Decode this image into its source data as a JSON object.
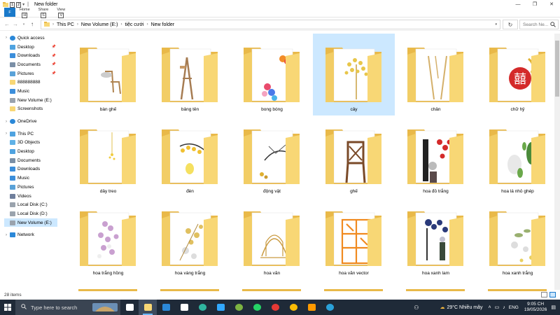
{
  "window": {
    "title": "New folder",
    "minimize_glyph": "—",
    "restore_glyph": "❐",
    "close_glyph": "✕"
  },
  "ribbon": {
    "file_label": "F",
    "tabs": [
      {
        "label": "Home",
        "keytip": "H"
      },
      {
        "label": "Share",
        "keytip": "S"
      },
      {
        "label": "View",
        "keytip": "V"
      }
    ],
    "qat_keytips": [
      "1",
      "2"
    ]
  },
  "address": {
    "crumbs": [
      "This PC",
      "New Volume (E:)",
      "tiệc cưới",
      "New folder"
    ],
    "search_placeholder": "Search Ne..."
  },
  "sidebar": {
    "items": [
      {
        "label": "Quick access",
        "icon": "star-icon",
        "top": true,
        "pinned": false
      },
      {
        "label": "Desktop",
        "icon": "desktop-folder-icon",
        "top": false,
        "pinned": true
      },
      {
        "label": "Downloads",
        "icon": "downloads-folder-icon",
        "top": false,
        "pinned": true
      },
      {
        "label": "Documents",
        "icon": "documents-folder-icon",
        "top": false,
        "pinned": true
      },
      {
        "label": "Pictures",
        "icon": "pictures-folder-icon",
        "top": false,
        "pinned": true
      },
      {
        "label": "888888888",
        "icon": "folder-icon",
        "top": false,
        "pinned": false
      },
      {
        "label": "Music",
        "icon": "music-icon",
        "top": false,
        "pinned": false
      },
      {
        "label": "New Volume (E:)",
        "icon": "drive-icon",
        "top": false,
        "pinned": false
      },
      {
        "label": "Screenshots",
        "icon": "folder-icon",
        "top": false,
        "pinned": false
      },
      {
        "gap": true
      },
      {
        "label": "OneDrive",
        "icon": "cloud-icon",
        "top": true,
        "pinned": false
      },
      {
        "gap": true
      },
      {
        "label": "This PC",
        "icon": "computer-icon",
        "top": true,
        "pinned": false
      },
      {
        "label": "3D Objects",
        "icon": "3d-objects-icon",
        "top": false,
        "pinned": false
      },
      {
        "label": "Desktop",
        "icon": "desktop-folder-icon",
        "top": false,
        "pinned": false
      },
      {
        "label": "Documents",
        "icon": "documents-folder-icon",
        "top": false,
        "pinned": false
      },
      {
        "label": "Downloads",
        "icon": "downloads-folder-icon",
        "top": false,
        "pinned": false
      },
      {
        "label": "Music",
        "icon": "music-icon",
        "top": false,
        "pinned": false
      },
      {
        "label": "Pictures",
        "icon": "pictures-folder-icon",
        "top": false,
        "pinned": false
      },
      {
        "label": "Videos",
        "icon": "videos-folder-icon",
        "top": false,
        "pinned": false
      },
      {
        "label": "Local Disk (C:)",
        "icon": "drive-icon",
        "top": false,
        "pinned": false
      },
      {
        "label": "Local Disk (D:)",
        "icon": "drive-icon",
        "top": false,
        "pinned": false
      },
      {
        "label": "New Volume (E:)",
        "icon": "drive-icon",
        "top": false,
        "pinned": false,
        "selected": true
      },
      {
        "gap": true
      },
      {
        "label": "Network",
        "icon": "network-icon",
        "top": true,
        "pinned": false
      }
    ]
  },
  "folders": [
    {
      "name": "bàn ghế",
      "thumb": "chair"
    },
    {
      "name": "bảng tên",
      "thumb": "easel"
    },
    {
      "name": "bong bóng",
      "thumb": "balloons"
    },
    {
      "name": "cây",
      "thumb": "tree",
      "selected": true
    },
    {
      "name": "chân",
      "thumb": "legs"
    },
    {
      "name": "chữ hỷ",
      "thumb": "double-happiness"
    },
    {
      "name": "dây treo",
      "thumb": "hanging"
    },
    {
      "name": "đèn",
      "thumb": "lamp"
    },
    {
      "name": "động vật",
      "thumb": "crane-bird"
    },
    {
      "name": "ghế",
      "thumb": "wood-chair"
    },
    {
      "name": "hoa đỏ trắng",
      "thumb": "red-white-flowers"
    },
    {
      "name": "hoa lá nhỏ ghép",
      "thumb": "leaves"
    },
    {
      "name": "hoa trắng hồng",
      "thumb": "pink-white-flowers"
    },
    {
      "name": "hoa vàng trắng",
      "thumb": "yellow-white-flowers"
    },
    {
      "name": "hoa văn",
      "thumb": "gold-pattern"
    },
    {
      "name": "hoa văn vector",
      "thumb": "orange-lattice"
    },
    {
      "name": "hoa xanh lam",
      "thumb": "blue-flowers"
    },
    {
      "name": "hoa xanh trắng",
      "thumb": "green-white-flowers"
    }
  ],
  "status": {
    "item_count": "28 items"
  },
  "taskbar": {
    "search_placeholder": "Type here to search",
    "weather": "29°C  Nhiều mây",
    "language": "ENG",
    "time": "9:05 CH",
    "date": "19/05/2026",
    "apps": [
      "task-view-icon",
      "file-explorer-icon",
      "store-icon",
      "mail-icon",
      "edge-icon",
      "photoshop-icon",
      "settings-icon",
      "whatsapp-icon",
      "app-icon",
      "chrome-icon",
      "illustrator-icon",
      "telegram-icon"
    ]
  },
  "colors": {
    "folder": "#f8d775",
    "folder_dark": "#e9b949",
    "selection": "#cce8ff",
    "taskbar": "#1f2a38",
    "accent": "#1979ca"
  }
}
